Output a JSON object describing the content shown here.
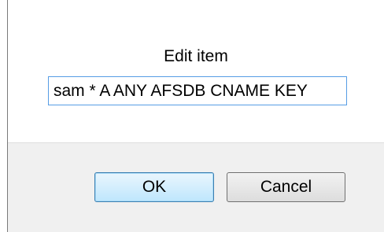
{
  "dialog": {
    "title": "Edit item",
    "input_value": "sam * A ANY AFSDB CNAME KEY"
  },
  "buttons": {
    "ok_label": "OK",
    "cancel_label": "Cancel"
  },
  "colors": {
    "input_border": "#569de5",
    "footer_background": "#f0f0f0",
    "ok_border": "#3c7fb1"
  }
}
